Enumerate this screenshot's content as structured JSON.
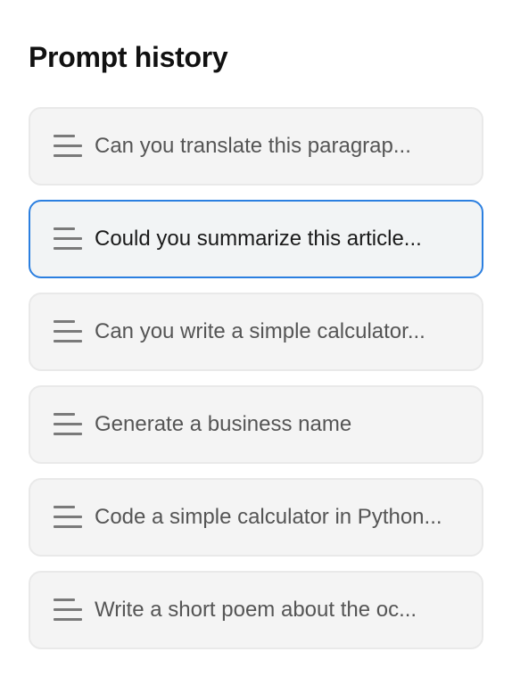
{
  "header": {
    "title": "Prompt history"
  },
  "history": {
    "selected_index": 1,
    "items": [
      {
        "label": "Can you translate this paragrap...",
        "icon": "lines-icon"
      },
      {
        "label": "Could you summarize this article...",
        "icon": "lines-icon"
      },
      {
        "label": "Can you write a simple calculator...",
        "icon": "lines-icon"
      },
      {
        "label": "Generate a business name",
        "icon": "lines-icon"
      },
      {
        "label": "Code a simple calculator in Python...",
        "icon": "lines-icon"
      },
      {
        "label": "Write a short poem about the oc...",
        "icon": "lines-icon"
      }
    ]
  },
  "colors": {
    "selected_border": "#2b7fe0",
    "item_background": "#f4f4f4",
    "icon": "#7a7a7a"
  }
}
